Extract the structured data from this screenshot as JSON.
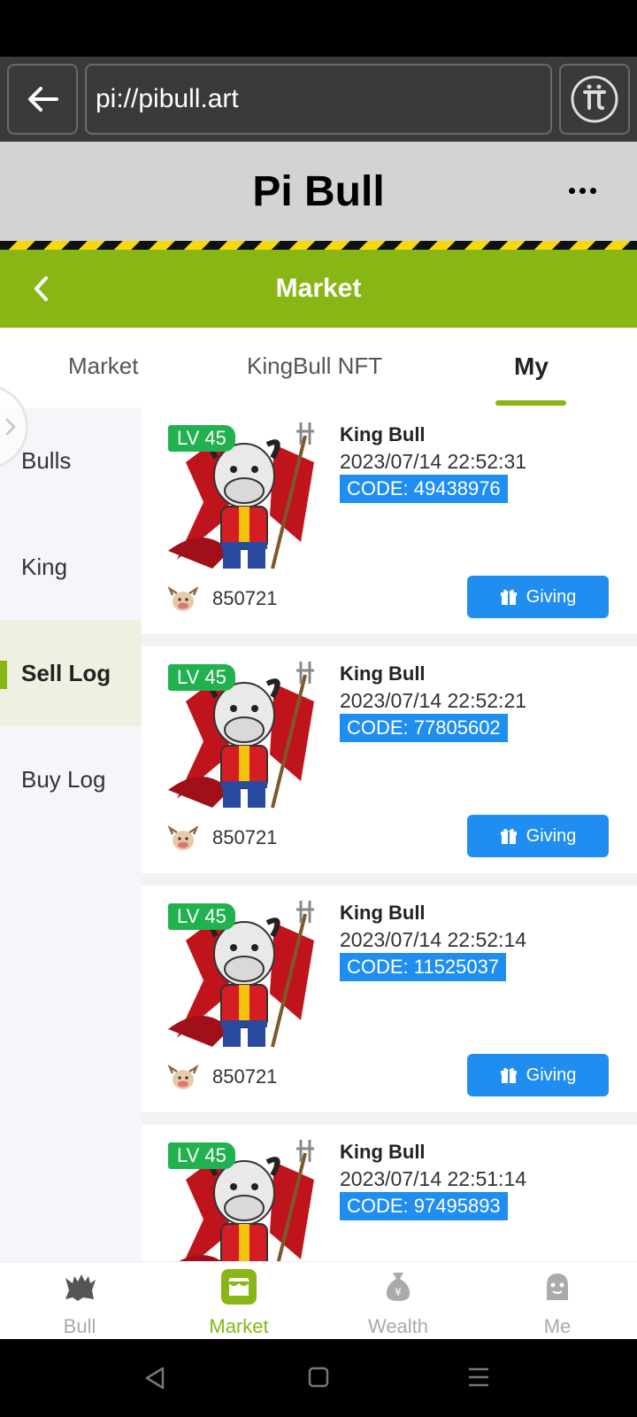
{
  "browser": {
    "url": "pi://pibull.art"
  },
  "header": {
    "title": "Pi Bull"
  },
  "nav": {
    "title": "Market"
  },
  "tabs": [
    {
      "label": "Market"
    },
    {
      "label": "KingBull NFT"
    },
    {
      "label": "My",
      "active": true
    }
  ],
  "sidebar": {
    "items": [
      {
        "label": "Bulls"
      },
      {
        "label": "King"
      },
      {
        "label": "Sell Log",
        "active": true
      },
      {
        "label": "Buy Log"
      }
    ]
  },
  "cards": [
    {
      "level": "LV 45",
      "name": "King Bull",
      "date": "2023/07/14 22:52:31",
      "code": "CODE: 49438976",
      "owner": "850721",
      "action": "Giving"
    },
    {
      "level": "LV 45",
      "name": "King Bull",
      "date": "2023/07/14 22:52:21",
      "code": "CODE: 77805602",
      "owner": "850721",
      "action": "Giving"
    },
    {
      "level": "LV 45",
      "name": "King Bull",
      "date": "2023/07/14 22:52:14",
      "code": "CODE: 11525037",
      "owner": "850721",
      "action": "Giving"
    },
    {
      "level": "LV 45",
      "name": "King Bull",
      "date": "2023/07/14 22:51:14",
      "code": "CODE: 97495893"
    }
  ],
  "bottom_nav": {
    "items": [
      {
        "label": "Bull",
        "icon": "bull-icon"
      },
      {
        "label": "Market",
        "icon": "market-icon",
        "active": true
      },
      {
        "label": "Wealth",
        "icon": "money-bag-icon"
      },
      {
        "label": "Me",
        "icon": "user-icon"
      }
    ]
  },
  "colors": {
    "accent": "#88b614",
    "primary_button": "#1f8ef0",
    "level_badge": "#21b14f"
  }
}
